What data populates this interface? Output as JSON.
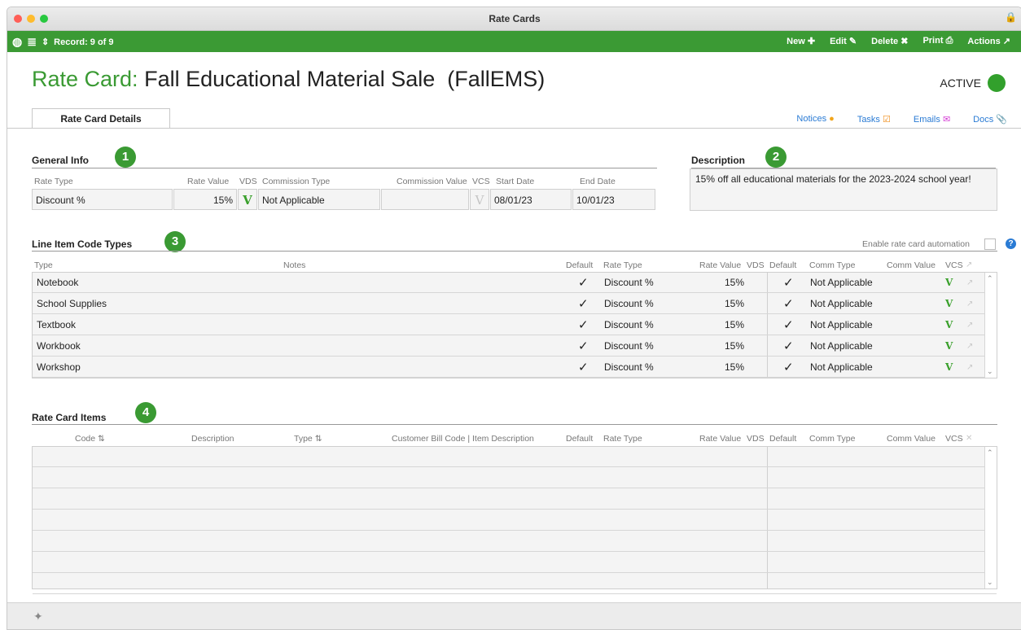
{
  "window": {
    "title": "Rate Cards"
  },
  "toolbar": {
    "record": "Record: 9 of 9",
    "new": "New",
    "edit": "Edit",
    "delete": "Delete",
    "print": "Print",
    "actions": "Actions"
  },
  "header": {
    "prefix": "Rate Card:",
    "name": "Fall Educational Material Sale  (FallEMS)",
    "status": "ACTIVE",
    "status_color": "#32a02c"
  },
  "tabs": {
    "details": "Rate Card Details"
  },
  "links": {
    "notices": "Notices",
    "tasks": "Tasks",
    "emails": "Emails",
    "docs": "Docs"
  },
  "general": {
    "title": "General Info",
    "badge": "1",
    "labels": {
      "rate_type": "Rate Type",
      "rate_value": "Rate Value",
      "vds": "VDS",
      "commission_type": "Commission Type",
      "commission_value": "Commission Value",
      "vcs": "VCS",
      "start_date": "Start Date",
      "end_date": "End Date"
    },
    "values": {
      "rate_type": "Discount %",
      "rate_value": "15%",
      "vds": "V",
      "commission_type": "Not Applicable",
      "commission_value": "",
      "vcs": "V",
      "start_date": "08/01/23",
      "end_date": "10/01/23"
    }
  },
  "description": {
    "title": "Description",
    "badge": "2",
    "text": "15% off all educational materials for the 2023-2024 school year!"
  },
  "line_items": {
    "title": "Line Item Code Types",
    "badge": "3",
    "automation_label": "Enable rate card automation",
    "help": "?",
    "columns": {
      "type": "Type",
      "notes": "Notes",
      "default": "Default",
      "rate_type": "Rate Type",
      "rate_value": "Rate Value",
      "vds": "VDS",
      "default2": "Default",
      "comm_type": "Comm Type",
      "comm_value": "Comm Value",
      "vcs": "VCS"
    },
    "rows": [
      {
        "type": "Notebook",
        "default": "✓",
        "rate_type": "Discount %",
        "rate_value": "15%",
        "default2": "✓",
        "comm_type": "Not Applicable",
        "vcs": "V"
      },
      {
        "type": "School Supplies",
        "default": "✓",
        "rate_type": "Discount %",
        "rate_value": "15%",
        "default2": "✓",
        "comm_type": "Not Applicable",
        "vcs": "V"
      },
      {
        "type": "Textbook",
        "default": "✓",
        "rate_type": "Discount %",
        "rate_value": "15%",
        "default2": "✓",
        "comm_type": "Not Applicable",
        "vcs": "V"
      },
      {
        "type": "Workbook",
        "default": "✓",
        "rate_type": "Discount %",
        "rate_value": "15%",
        "default2": "✓",
        "comm_type": "Not Applicable",
        "vcs": "V"
      },
      {
        "type": "Workshop",
        "default": "✓",
        "rate_type": "Discount %",
        "rate_value": "15%",
        "default2": "✓",
        "comm_type": "Not Applicable",
        "vcs": "V"
      }
    ]
  },
  "rate_items": {
    "title": "Rate Card Items",
    "badge": "4",
    "columns": {
      "code": "Code",
      "description": "Description",
      "type": "Type",
      "bill_code": "Customer Bill Code | Item Description",
      "default": "Default",
      "rate_type": "Rate Type",
      "rate_value": "Rate Value",
      "vds": "VDS",
      "default2": "Default",
      "comm_type": "Comm Type",
      "comm_value": "Comm Value",
      "vcs": "VCS"
    }
  }
}
